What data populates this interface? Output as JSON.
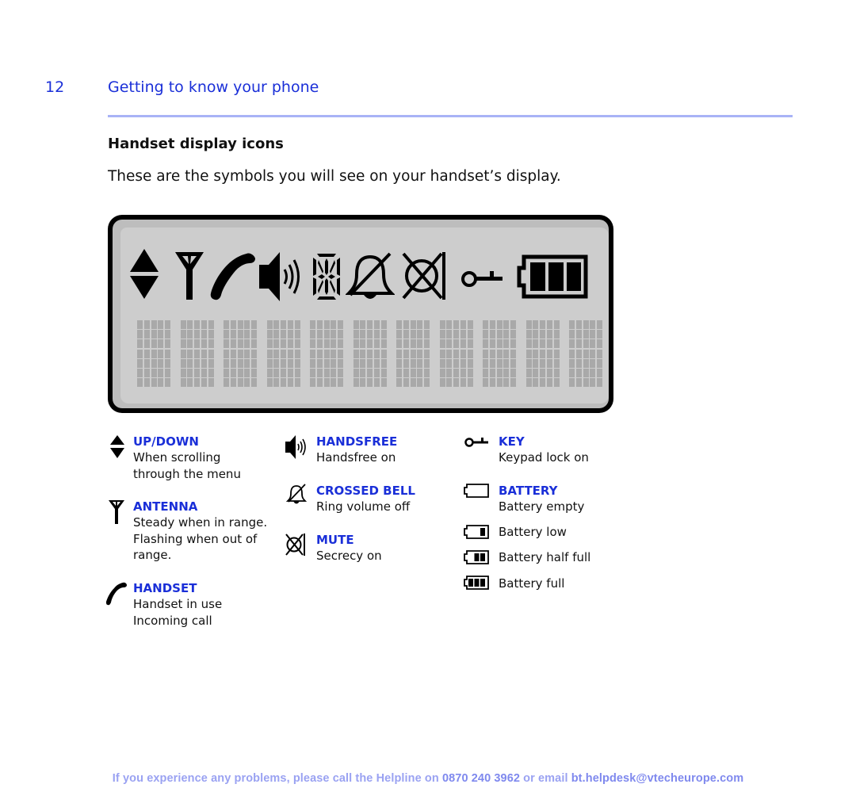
{
  "header": {
    "page_number": "12",
    "chapter_title": "Getting to know your phone"
  },
  "section": {
    "title": "Handset display icons",
    "intro": "These are the symbols you will see on your handset’s display."
  },
  "lcd": {
    "icons": [
      "up-down-arrows-icon",
      "antenna-icon",
      "handset-icon",
      "handsfree-speaker-icon",
      "segment-character-icon",
      "crossed-bell-icon",
      "mute-icon",
      "key-icon",
      "battery-full-icon"
    ],
    "dot_matrix_characters": 11,
    "colors": {
      "frame": "#000000",
      "face": "#cdcdcd",
      "shadow": "#bdbdbd",
      "pixel": "#a9a9a9"
    }
  },
  "legend": {
    "up_down": {
      "title": "UP/DOWN",
      "desc": [
        "When scrolling",
        "through the menu"
      ],
      "icon": "up-down-arrows-icon"
    },
    "antenna": {
      "title": "ANTENNA",
      "desc": [
        "Steady when in range.",
        "Flashing when out of",
        "range."
      ],
      "icon": "antenna-icon"
    },
    "handset": {
      "title": "HANDSET",
      "desc": [
        "Handset in use",
        "Incoming call"
      ],
      "icon": "handset-icon"
    },
    "handsfree": {
      "title": "HANDSFREE",
      "desc": [
        "Handsfree on"
      ],
      "icon": "handsfree-speaker-icon"
    },
    "crossed_bell": {
      "title": "CROSSED BELL",
      "desc": [
        "Ring volume off"
      ],
      "icon": "crossed-bell-icon"
    },
    "mute": {
      "title": "MUTE",
      "desc": [
        "Secrecy on"
      ],
      "icon": "mute-icon"
    },
    "key": {
      "title": "KEY",
      "desc": [
        "Keypad lock on"
      ],
      "icon": "key-icon"
    },
    "battery": {
      "title": "BATTERY",
      "levels": [
        {
          "label": "Battery empty",
          "bars": 0,
          "icon": "battery-empty-icon"
        },
        {
          "label": "Battery low",
          "bars": 1,
          "icon": "battery-low-icon"
        },
        {
          "label": "Battery half full",
          "bars": 2,
          "icon": "battery-half-icon"
        },
        {
          "label": "Battery full",
          "bars": 3,
          "icon": "battery-full-icon"
        }
      ]
    }
  },
  "footer": {
    "text_before": "If you experience any problems, please call the Helpline on ",
    "phone": "0870 240 3962",
    "text_middle": " or email ",
    "email": "bt.helpdesk@vtecheurope.com"
  },
  "colors": {
    "accent": "#1a2fd8",
    "rule": "#a9b3f6",
    "footer": "#9aa2f2"
  }
}
